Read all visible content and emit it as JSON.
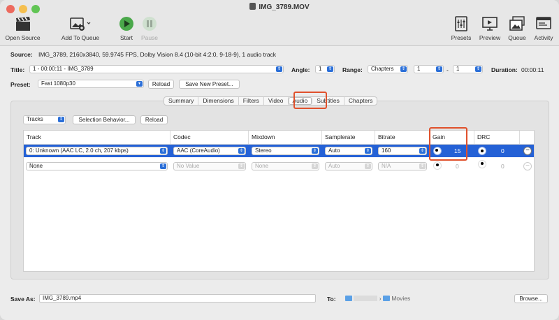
{
  "window": {
    "title": "IMG_3789.MOV"
  },
  "toolbar": {
    "open_source": "Open Source",
    "add_to_queue": "Add To Queue",
    "start": "Start",
    "pause": "Pause",
    "presets": "Presets",
    "preview": "Preview",
    "queue": "Queue",
    "activity": "Activity"
  },
  "source": {
    "label": "Source:",
    "value": "IMG_3789, 2160x3840, 59.9745 FPS, Dolby Vision 8.4 (10-bit 4:2:0, 9-18-9), 1 audio track"
  },
  "title_row": {
    "title_label": "Title:",
    "title_value": "1 - 00:00:11 - IMG_3789",
    "angle_label": "Angle:",
    "angle_value": "1",
    "range_label": "Range:",
    "range_value": "Chapters",
    "range_from": "1",
    "range_sep": "-",
    "range_to": "1",
    "duration_label": "Duration:",
    "duration_value": "00:00:11"
  },
  "preset": {
    "label": "Preset:",
    "value": "Fast 1080p30",
    "reload": "Reload",
    "save_new": "Save New Preset..."
  },
  "tabs": [
    "Summary",
    "Dimensions",
    "Filters",
    "Video",
    "Audio",
    "Subtitles",
    "Chapters"
  ],
  "selected_tab": "Audio",
  "audio": {
    "tracks_button": "Tracks",
    "selection_behavior": "Selection Behavior...",
    "reload": "Reload",
    "columns": [
      "Track",
      "Codec",
      "Mixdown",
      "Samplerate",
      "Bitrate",
      "Gain",
      "DRC"
    ],
    "rows": [
      {
        "track": "0: Unknown (AAC LC, 2.0 ch, 207 kbps)",
        "codec": "AAC (CoreAudio)",
        "mixdown": "Stereo",
        "samplerate": "Auto",
        "bitrate": "160",
        "gain": "15",
        "drc": "0"
      },
      {
        "track": "None",
        "codec": "No Value",
        "mixdown": "None",
        "samplerate": "Auto",
        "bitrate": "N/A",
        "gain": "0",
        "drc": "0"
      }
    ]
  },
  "save": {
    "label": "Save As:",
    "value": "IMG_3789.mp4",
    "to_label": "To:",
    "path_sep": "›",
    "folder": "Movies",
    "browse": "Browse..."
  },
  "colors": {
    "accent": "#2461d6",
    "highlight": "#e0512c"
  }
}
